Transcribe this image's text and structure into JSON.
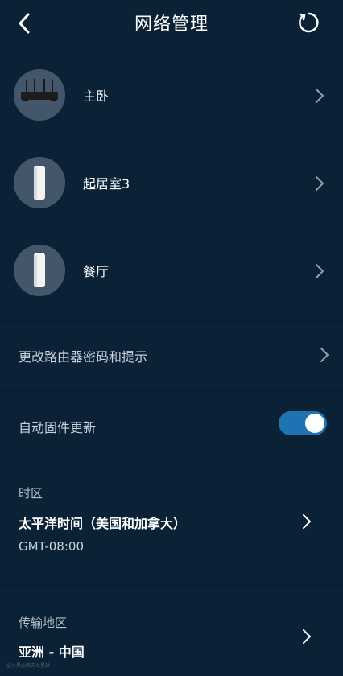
{
  "header": {
    "title": "网络管理",
    "back_icon": "back-arrow-icon",
    "refresh_icon": "refresh-icon"
  },
  "devices": [
    {
      "label": "主卧",
      "icon": "router-icon"
    },
    {
      "label": "起居室3",
      "icon": "mesh-node-icon"
    },
    {
      "label": "餐厅",
      "icon": "mesh-node-icon"
    }
  ],
  "settings": {
    "change_password_label": "更改路由器密码和提示",
    "auto_update_label": "自动固件更新",
    "auto_update_enabled": true
  },
  "timezone": {
    "title": "时区",
    "value": "太平洋时间（美国和加拿大）",
    "offset": "GMT-08:00"
  },
  "transmission": {
    "title": "传输地区",
    "value": "亚洲 - 中国"
  },
  "colors": {
    "background": "#0b2236",
    "toggle_on": "#1f73b2",
    "avatar_bg": "#43566a"
  },
  "watermark": "@小黑@西方七星球"
}
